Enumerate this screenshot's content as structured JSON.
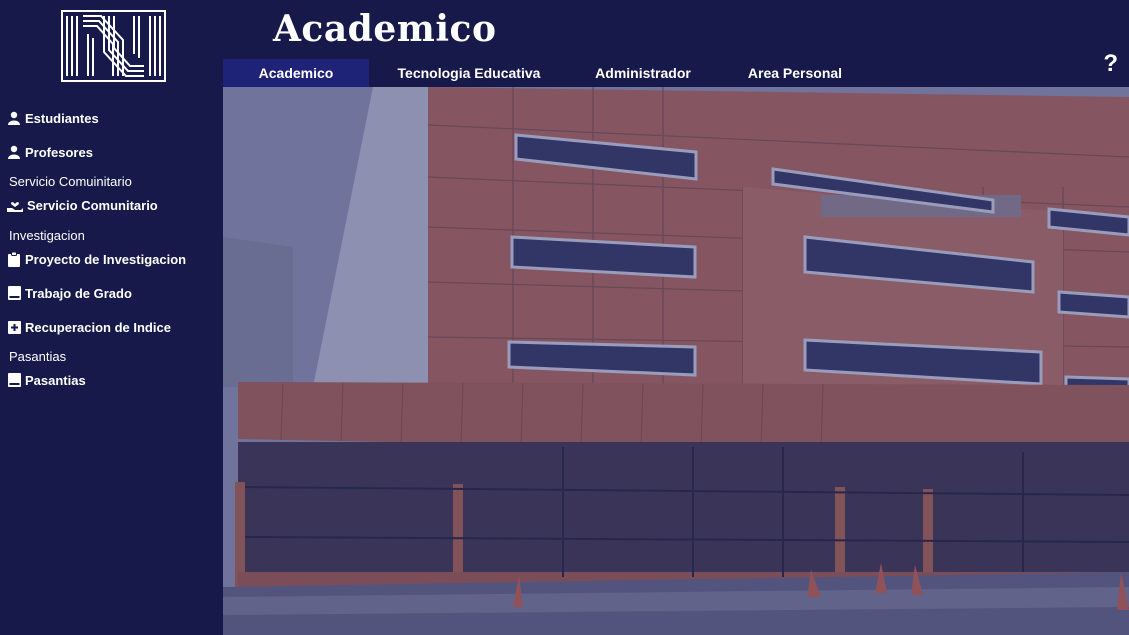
{
  "header": {
    "title": "Academico",
    "help_label": "?",
    "tabs": [
      {
        "label": "Academico"
      },
      {
        "label": "Tecnologia Educativa"
      },
      {
        "label": "Administrador"
      },
      {
        "label": "Area Personal"
      }
    ]
  },
  "sidebar": {
    "items": [
      {
        "label": "Estudiantes",
        "icon": "user-icon"
      },
      {
        "label": "Profesores",
        "icon": "user-icon"
      },
      {
        "label": "Servicio Comunitario",
        "icon": "hand-heart-icon"
      },
      {
        "label": "Proyecto de Investigacion",
        "icon": "clipboard-icon"
      },
      {
        "label": "Trabajo de Grado",
        "icon": "book-icon"
      },
      {
        "label": "Recuperacion de Indice",
        "icon": "plus-box-icon"
      },
      {
        "label": "Pasantias",
        "icon": "book-icon"
      }
    ],
    "sections": [
      {
        "label": "Servicio Comuinitario"
      },
      {
        "label": "Investigacion"
      },
      {
        "label": "Pasantias"
      }
    ]
  },
  "colors": {
    "background": "#16194a",
    "active_tab": "#1f2378",
    "text": "#ffffff"
  }
}
